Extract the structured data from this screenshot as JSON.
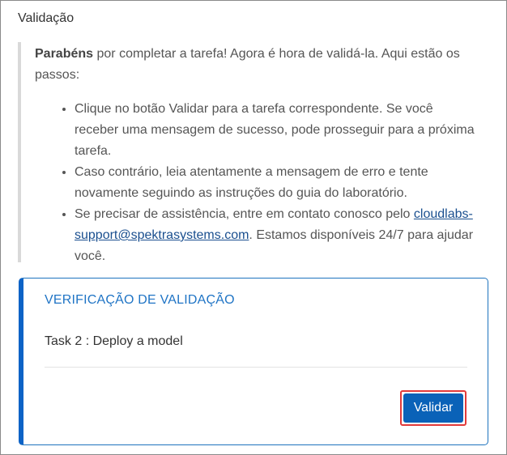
{
  "section": {
    "title": "Validação"
  },
  "intro": {
    "bold": "Parabéns",
    "text": " por completar a tarefa! Agora é hora de validá-la. Aqui estão os passos:"
  },
  "steps": {
    "item1": "Clique no botão Validar para a tarefa correspondente. Se você receber uma mensagem de sucesso, pode prosseguir para a próxima tarefa.",
    "item2": "Caso contrário, leia atentamente a mensagem de erro e tente novamente seguindo as instruções do guia do laboratório.",
    "item3_before": "Se precisar de assistência, entre em contato conosco pelo ",
    "item3_link": "cloudlabs-support@spektrasystems.com",
    "item3_after": ". Estamos disponíveis 24/7 para ajudar você."
  },
  "validation_card": {
    "title": "VERIFICAÇÃO DE VALIDAÇÃO",
    "task": "Task 2 : Deploy a model",
    "button_label": "Validar"
  },
  "colors": {
    "accent": "#0d63c6",
    "title_blue": "#1f74c5",
    "button_blue": "#0a62b8",
    "highlight_red": "#e23a3a",
    "link": "#1a4f8f"
  }
}
